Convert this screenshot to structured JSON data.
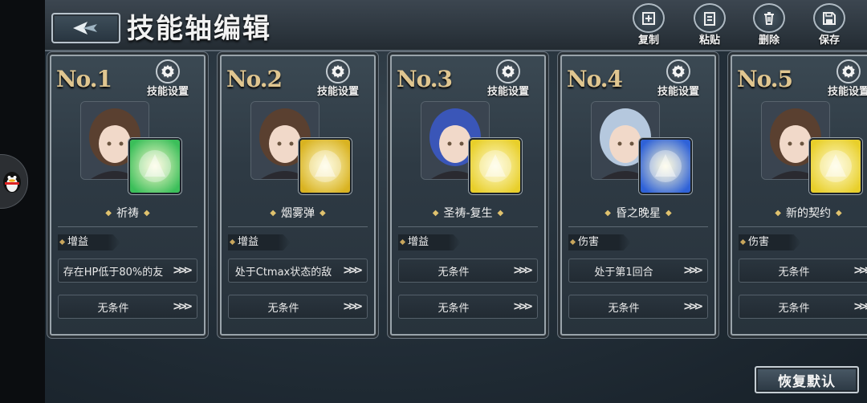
{
  "header": {
    "title": "技能轴编辑",
    "tools": [
      {
        "label": "复制",
        "icon": "copy-icon"
      },
      {
        "label": "粘贴",
        "icon": "paste-icon"
      },
      {
        "label": "删除",
        "icon": "trash-icon"
      },
      {
        "label": "保存",
        "icon": "save-icon"
      }
    ]
  },
  "cards": [
    {
      "no": "No.1",
      "setting_label": "技能设置",
      "skill": "祈祷",
      "tag": "增益",
      "cond1": "存在HP低于80%的友",
      "cond2": "无条件",
      "skill_color": "#3bbf5a",
      "hair_color": "#5a4030"
    },
    {
      "no": "No.2",
      "setting_label": "技能设置",
      "skill": "烟雾弹",
      "tag": "增益",
      "cond1": "处于Ctmax状态的敌",
      "cond2": "无条件",
      "skill_color": "#d9b321",
      "hair_color": "#5a4030"
    },
    {
      "no": "No.3",
      "setting_label": "技能设置",
      "skill": "圣祷-复生",
      "tag": "增益",
      "cond1": "无条件",
      "cond2": "无条件",
      "skill_color": "#e8cf2a",
      "hair_color": "#3a56b8"
    },
    {
      "no": "No.4",
      "setting_label": "技能设置",
      "skill": "昏之晚星",
      "tag": "伤害",
      "cond1": "处于第1回合",
      "cond2": "无条件",
      "skill_color": "#2f62d8",
      "hair_color": "#b5c8de"
    },
    {
      "no": "No.5",
      "setting_label": "技能设置",
      "skill": "新的契约",
      "tag": "伤害",
      "cond1": "无条件",
      "cond2": "无条件",
      "skill_color": "#e8cf2a",
      "hair_color": "#5a4030"
    }
  ],
  "footer": {
    "reset_label": "恢复默认"
  }
}
